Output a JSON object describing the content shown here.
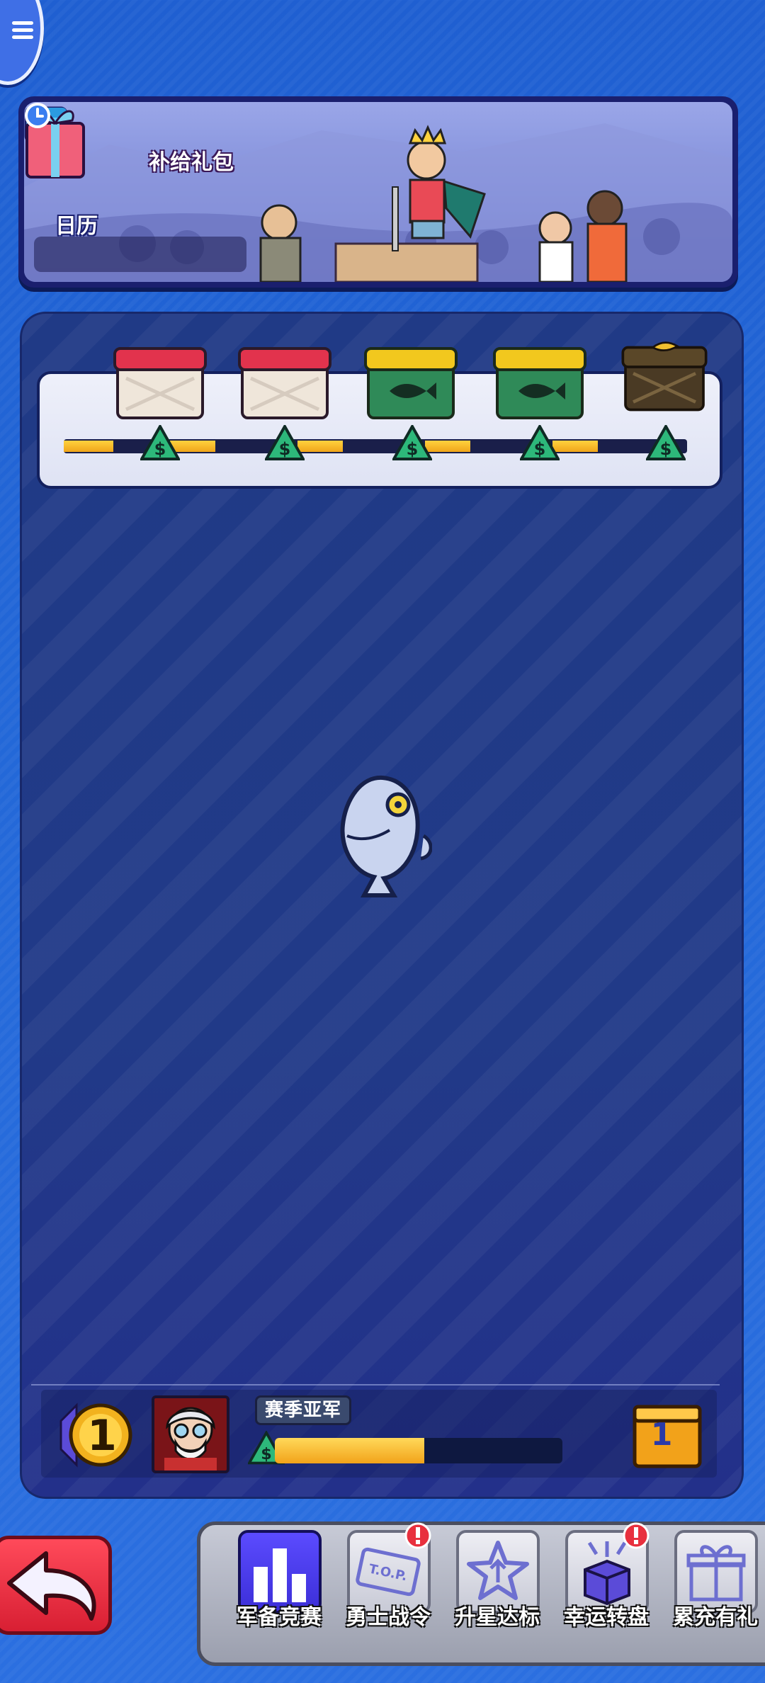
{
  "banner": {
    "calendar_label": "日历",
    "gift_pack_label": "补给礼包"
  },
  "season": {
    "rank_title": "赛季亚军",
    "rank_number": "1",
    "crate_count": "1",
    "progress_fraction": 0.52
  },
  "track": {
    "chests": [
      "red-crate-chest",
      "red-crate-chest",
      "fish-crate-chest",
      "fish-crate-chest",
      "golden-fish-chest"
    ],
    "segment_fill": [
      0.55,
      0.5,
      0.5,
      0.5,
      0.5
    ]
  },
  "bottom_tabs": [
    {
      "label": "军备竞赛",
      "icon": "bar-chart-icon",
      "active": true,
      "alert": false
    },
    {
      "label": "勇士战令",
      "icon": "top-ticket-icon",
      "active": false,
      "alert": true
    },
    {
      "label": "升星达标",
      "icon": "star-up-icon",
      "active": false,
      "alert": false
    },
    {
      "label": "幸运转盘",
      "icon": "lucky-box-icon",
      "active": false,
      "alert": true
    },
    {
      "label": "累充有礼",
      "icon": "gift-icon",
      "active": false,
      "alert": false
    }
  ],
  "colors": {
    "background": "#2368d8",
    "panel": "#213a88",
    "progress": "#f2a31a",
    "back_button": "#d81f33"
  }
}
